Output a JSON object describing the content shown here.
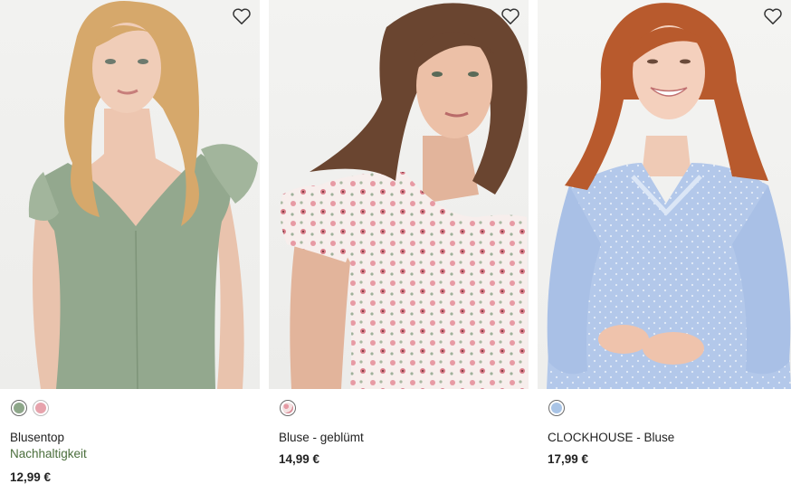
{
  "products": [
    {
      "name": "Blusentop",
      "badge": "Nachhaltigkeit",
      "price": "12,99 €",
      "wishlist_icon": "heart-outline-icon",
      "swatches": [
        {
          "color": "#8ea78a",
          "selected": true
        },
        {
          "color": "#e7a3ac",
          "selected": false
        }
      ]
    },
    {
      "name": "Bluse - geblümt",
      "price": "14,99 €",
      "wishlist_icon": "heart-outline-icon",
      "swatches": [
        {
          "color": "#efc9cd",
          "selected": true
        }
      ]
    },
    {
      "name": "CLOCKHOUSE - Bluse",
      "price": "17,99 €",
      "wishlist_icon": "heart-outline-icon",
      "swatches": [
        {
          "color": "#a9c4e6",
          "selected": true
        }
      ]
    }
  ],
  "colors": {
    "badge_green": "#4b6e3c",
    "text": "#222222"
  }
}
